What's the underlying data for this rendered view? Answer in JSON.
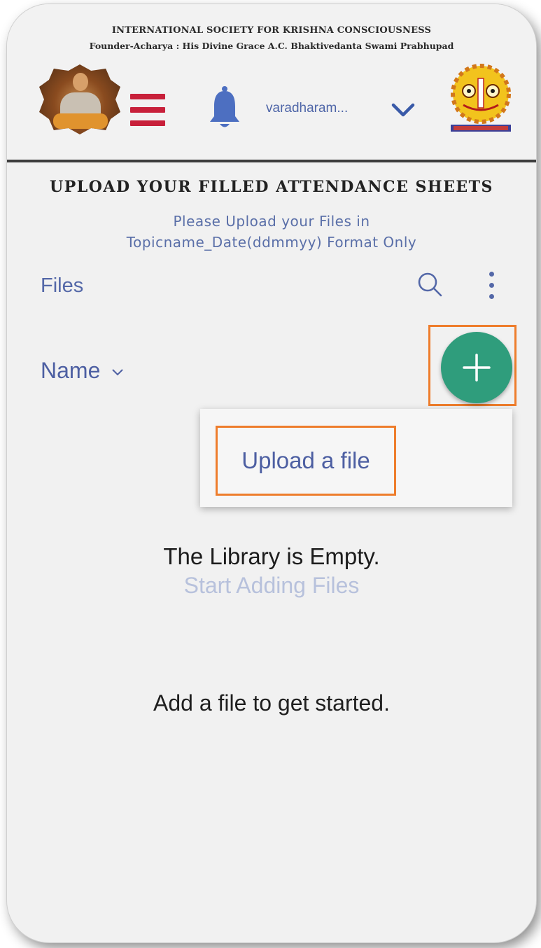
{
  "header": {
    "org_line1": "INTERNATIONAL SOCIETY FOR KRISHNA CONSCIOUSNESS",
    "org_line2": "Founder-Acharya : His Divine Grace A.C. Bhaktivedanta Swami Prabhupad",
    "user_name": "varadharam...",
    "colors": {
      "menu_icon": "#c8203a",
      "bell_icon": "#4d6fc1",
      "user_text": "#4f66a8"
    }
  },
  "page": {
    "title": "UPLOAD YOUR FILLED ATTENDANCE SHEETS",
    "hint_line1": "Please Upload your Files in",
    "hint_line2": "Topicname_Date(ddmmyy) Format Only"
  },
  "files_panel": {
    "label": "Files",
    "sort_label": "Name",
    "menu": {
      "upload_label": "Upload a file"
    },
    "empty_title": "The Library is Empty.",
    "empty_subtitle": "Start Adding Files",
    "get_started": "Add a file to get started.",
    "colors": {
      "fab": "#2f9d7c",
      "highlight": "#ee7d2c"
    }
  }
}
